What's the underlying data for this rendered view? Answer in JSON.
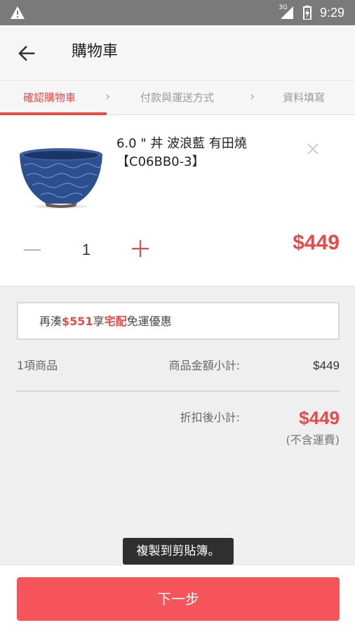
{
  "status_bar": {
    "network": "3G",
    "time": "9:29",
    "icons": [
      "warning-icon",
      "signal-icon",
      "battery-icon"
    ]
  },
  "app_bar": {
    "title": "購物車",
    "back_icon": "arrow-left-icon"
  },
  "steps": [
    {
      "label": "確認購物車",
      "active": true
    },
    {
      "label": "付款與運送方式",
      "active": false
    },
    {
      "label": "資料填寫",
      "active": false
    }
  ],
  "cart_item": {
    "name": "6.0 \" 丼 波浪藍 有田燒【C06BB0-3】",
    "quantity": "1",
    "price": "$449"
  },
  "promo": {
    "prefix": "再湊",
    "amount": "$551",
    "middle": "享",
    "method": "宅配",
    "suffix": "免運優惠"
  },
  "summary": {
    "item_count": "1項商品",
    "subtotal_label": "商品金額小計:",
    "subtotal_value": "$449",
    "discount_label": "折扣後小計:",
    "discount_value": "$449",
    "shipping_note": "(不含運費)"
  },
  "toast": "複製到剪貼簿。",
  "next_button": "下一步",
  "colors": {
    "accent": "#e84a4a",
    "button": "#f5545a",
    "status_bar": "#7a7a7a",
    "bowl": "#2d4f8f"
  }
}
